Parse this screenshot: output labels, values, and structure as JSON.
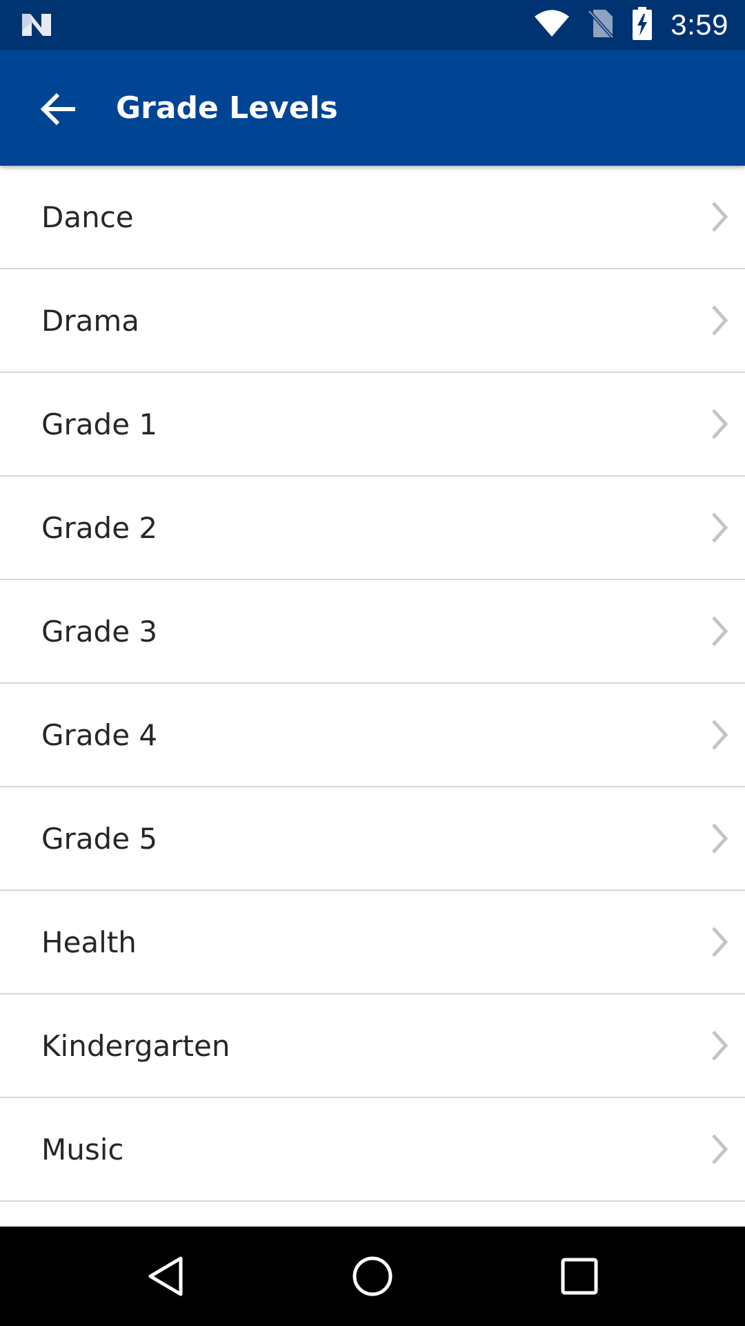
{
  "status_bar": {
    "time": "3:59",
    "left_icon": "n-notification-icon",
    "icons": [
      "wifi-icon",
      "no-sim-icon",
      "battery-charging-icon"
    ]
  },
  "app_bar": {
    "title": "Grade Levels",
    "back_icon": "back-arrow-icon",
    "background_color": "#004494"
  },
  "list": {
    "items": [
      {
        "label": "Dance"
      },
      {
        "label": "Drama"
      },
      {
        "label": "Grade 1"
      },
      {
        "label": "Grade 2"
      },
      {
        "label": "Grade 3"
      },
      {
        "label": "Grade 4"
      },
      {
        "label": "Grade 5"
      },
      {
        "label": "Health"
      },
      {
        "label": "Kindergarten"
      },
      {
        "label": "Music"
      },
      {
        "label": ""
      }
    ],
    "chevron_icon": "chevron-right-icon"
  },
  "nav_bar": {
    "buttons": [
      "nav-back-icon",
      "nav-home-icon",
      "nav-recents-icon"
    ]
  },
  "colors": {
    "status_bar": "#003371",
    "app_bar": "#004494",
    "divider": "#d6d6d6",
    "chevron": "#c4c4c4",
    "text": "#262626"
  }
}
